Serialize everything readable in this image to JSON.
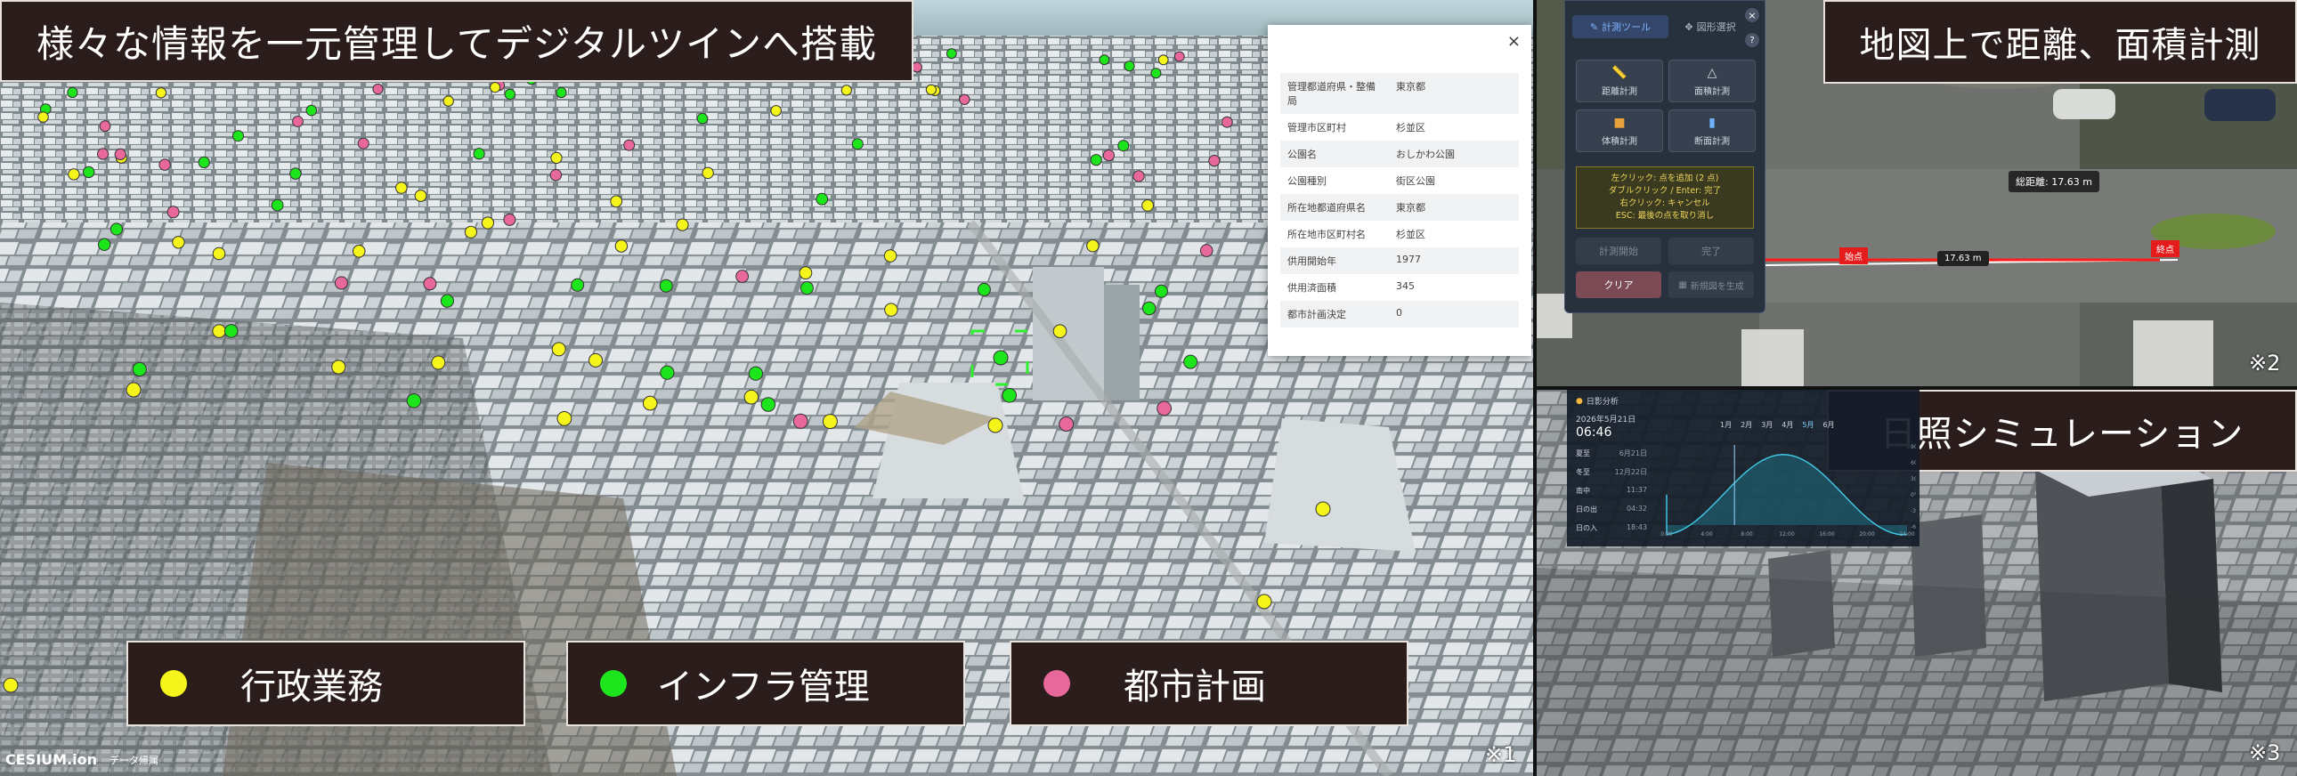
{
  "captions": {
    "main": "様々な情報を一元管理してデジタルツインへ搭載",
    "measure": "地図上で距離、面積計測",
    "sunlight": "日照シミュレーション"
  },
  "legend": [
    {
      "label": "行政業務",
      "color": "#f5f51c"
    },
    {
      "label": "インフラ管理",
      "color": "#1ce51c"
    },
    {
      "label": "都市計画",
      "color": "#e8689c"
    }
  ],
  "notes": {
    "n1": "※1",
    "n2": "※2",
    "n3": "※3"
  },
  "attribution": {
    "logo": "CESIUM.ion",
    "data": "データ帰属"
  },
  "info_popup": {
    "close": "×",
    "rows": [
      {
        "key": "管理都道府県・整備局",
        "value": "東京都"
      },
      {
        "key": "管理市区町村",
        "value": "杉並区"
      },
      {
        "key": "公園名",
        "value": "おしかわ公園"
      },
      {
        "key": "公園種別",
        "value": "街区公園"
      },
      {
        "key": "所在地都道府県名",
        "value": "東京都"
      },
      {
        "key": "所在地市区町村名",
        "value": "杉並区"
      },
      {
        "key": "供用開始年",
        "value": "1977"
      },
      {
        "key": "供用済面積",
        "value": "345"
      },
      {
        "key": "都市計画決定",
        "value": "0"
      }
    ]
  },
  "measure_tool": {
    "tab_measure": "計測ツール",
    "tab_shape": "図形選択",
    "close": "×",
    "help_icon": "?",
    "btn_distance": "距離計測",
    "btn_area": "面積計測",
    "btn_volume": "体積計測",
    "btn_section": "断面計測",
    "help_lines": [
      "左クリック: 点を追加 (2 点)",
      "ダブルクリック / Enter: 完了",
      "右クリック: キャンセル",
      "ESC: 最後の点を取り消し"
    ],
    "btn_start": "計測開始",
    "btn_done": "完了",
    "btn_clear": "クリア",
    "btn_new": "新規図を生成",
    "total_distance": "総距離: 17.63 m",
    "segment": "17.63 m",
    "start_label": "始点",
    "end_label": "終点"
  },
  "sun_panel": {
    "title": "日影分析",
    "date": "2026年5月21日",
    "time": "06:46",
    "months": [
      "1月",
      "2月",
      "3月",
      "4月",
      "5月",
      "6月"
    ],
    "stats": [
      {
        "k": "夏至",
        "v": "6月21日"
      },
      {
        "k": "冬至",
        "v": "12月22日"
      },
      {
        "k": "南中",
        "v": "11:37"
      },
      {
        "k": "日の出",
        "v": "04:32"
      },
      {
        "k": "日の入",
        "v": "18:43"
      }
    ],
    "x_ticks": [
      "0:00",
      "4:00",
      "8:00",
      "12:00",
      "16:00",
      "20:00",
      "24:00"
    ],
    "y_ticks": [
      "90°",
      "60°",
      "30°",
      "0°",
      "-30°",
      "-60°"
    ]
  }
}
